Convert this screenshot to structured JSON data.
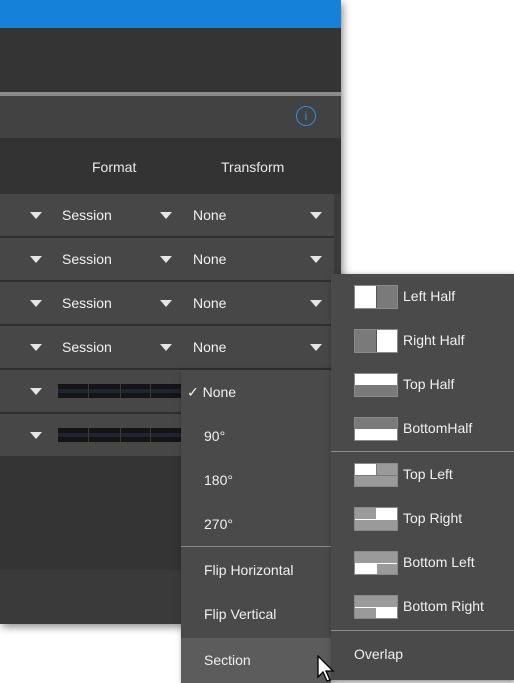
{
  "header": {
    "format_label": "Format",
    "transform_label": "Transform"
  },
  "rows": [
    {
      "format": "Session",
      "transform": "None"
    },
    {
      "format": "Session",
      "transform": "None"
    },
    {
      "format": "Session",
      "transform": "None"
    },
    {
      "format": "Session",
      "transform": "None"
    }
  ],
  "transform_menu": {
    "items": [
      {
        "label": "None",
        "checked": true
      },
      {
        "label": "90°"
      },
      {
        "label": "180°"
      },
      {
        "label": "270°"
      },
      {
        "label": "Flip Horizontal"
      },
      {
        "label": "Flip Vertical"
      },
      {
        "label": "Section",
        "has_submenu": true
      }
    ],
    "check_mark": "✓"
  },
  "section_submenu": {
    "items": [
      {
        "label": "Left Half",
        "icon": "left-half-icon"
      },
      {
        "label": "Right Half",
        "icon": "right-half-icon"
      },
      {
        "label": "Top Half",
        "icon": "top-half-icon"
      },
      {
        "label": "BottomHalf",
        "icon": "bottom-half-icon"
      },
      {
        "label": "Top Left",
        "icon": "top-left-icon"
      },
      {
        "label": "Top Right",
        "icon": "top-right-icon"
      },
      {
        "label": "Bottom Left",
        "icon": "bottom-left-icon"
      },
      {
        "label": "Bottom Right",
        "icon": "bottom-right-icon"
      },
      {
        "label": "Overlap"
      }
    ]
  },
  "info_icon_glyph": "i",
  "colors": {
    "title_bar": "#1581d8",
    "accent_info": "#2c8fe4",
    "menu_bg": "#4a4a4a"
  }
}
